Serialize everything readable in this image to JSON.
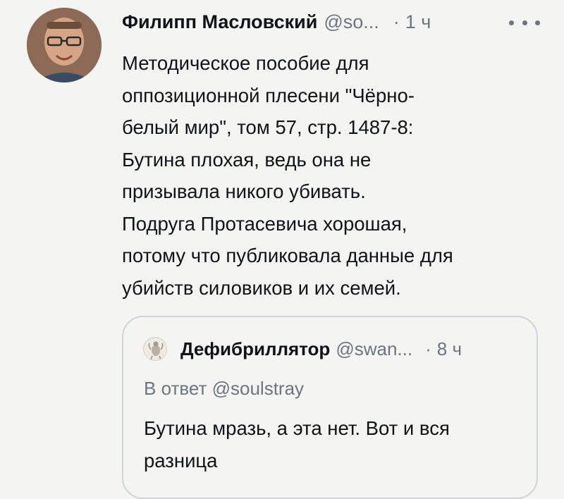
{
  "tweet": {
    "author_name": "Филипп Масловский",
    "author_handle": "@so...",
    "separator": "·",
    "time": "1 ч",
    "more_icon": "more-horizontal-icon",
    "text_lines": [
      "Методическое пособие для",
      "оппозиционной плесени \"Чёрно-",
      "белый мир\", том 57, стр. 1487-8:",
      "Бутина плохая, ведь она не",
      "призывала никого убивать.",
      "Подруга Протасевича хорошая,",
      "потому что публиковала данные для",
      "убийств силовиков и их семей."
    ]
  },
  "quote": {
    "author_name": "Дефибриллятор",
    "author_handle": "@swan...",
    "separator": "·",
    "time": "8 ч",
    "reply_to": "В ответ @soulstray",
    "text_lines": [
      "Бутина мразь, а эта нет. Вот и вся",
      "разница"
    ]
  },
  "colors": {
    "background": "#f4f4f2",
    "text": "#101418",
    "secondary_text": "#6b7680",
    "border": "#cfd4d9"
  }
}
